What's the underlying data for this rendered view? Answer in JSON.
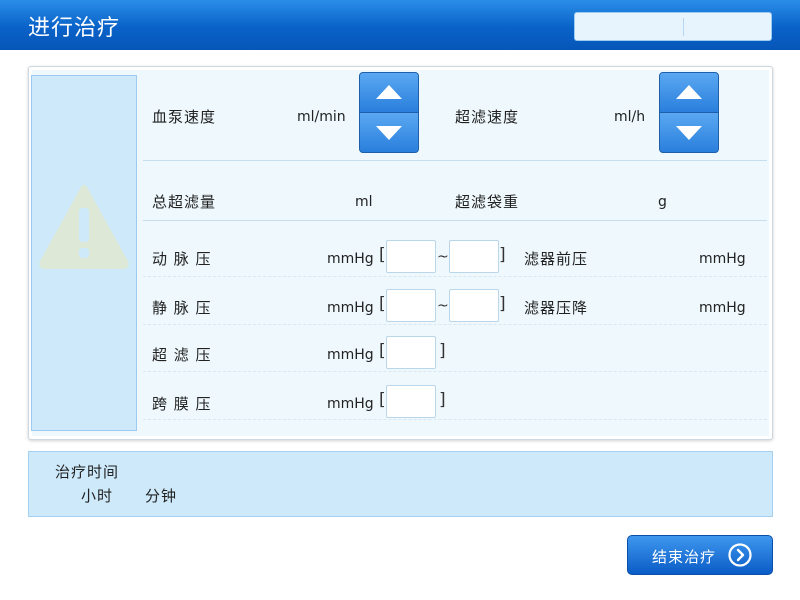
{
  "header": {
    "title": "进行治疗"
  },
  "rows": {
    "blood_pump_speed": {
      "label": "血泵速度",
      "unit": "ml/min"
    },
    "uf_speed": {
      "label": "超滤速度",
      "unit": "ml/h"
    },
    "total_uf": {
      "label": "总超滤量",
      "unit": "ml"
    },
    "uf_bag_weight": {
      "label": "超滤袋重",
      "unit": "g"
    },
    "arterial_pressure": {
      "label": "动 脉 压",
      "unit": "mmHg"
    },
    "filter_pre_pressure": {
      "label": "滤器前压",
      "unit": "mmHg"
    },
    "venous_pressure": {
      "label": "静 脉 压",
      "unit": "mmHg"
    },
    "filter_pressure_drop": {
      "label": "滤器压降",
      "unit": "mmHg"
    },
    "uf_pressure": {
      "label": "超 滤 压",
      "unit": "mmHg"
    },
    "tmp": {
      "label": "跨 膜 压",
      "unit": "mmHg"
    }
  },
  "range": {
    "open": "[",
    "close": "]",
    "separator": "~"
  },
  "treatment_time": {
    "title": "治疗时间",
    "hours_label": "小时",
    "minutes_label": "分钟"
  },
  "end_button": {
    "label": "结束治疗"
  },
  "colors": {
    "header": "#0a62c8",
    "accent": "#2f86e0",
    "panel_bg": "#eef8fd",
    "alert_bg": "#cde9fa"
  }
}
